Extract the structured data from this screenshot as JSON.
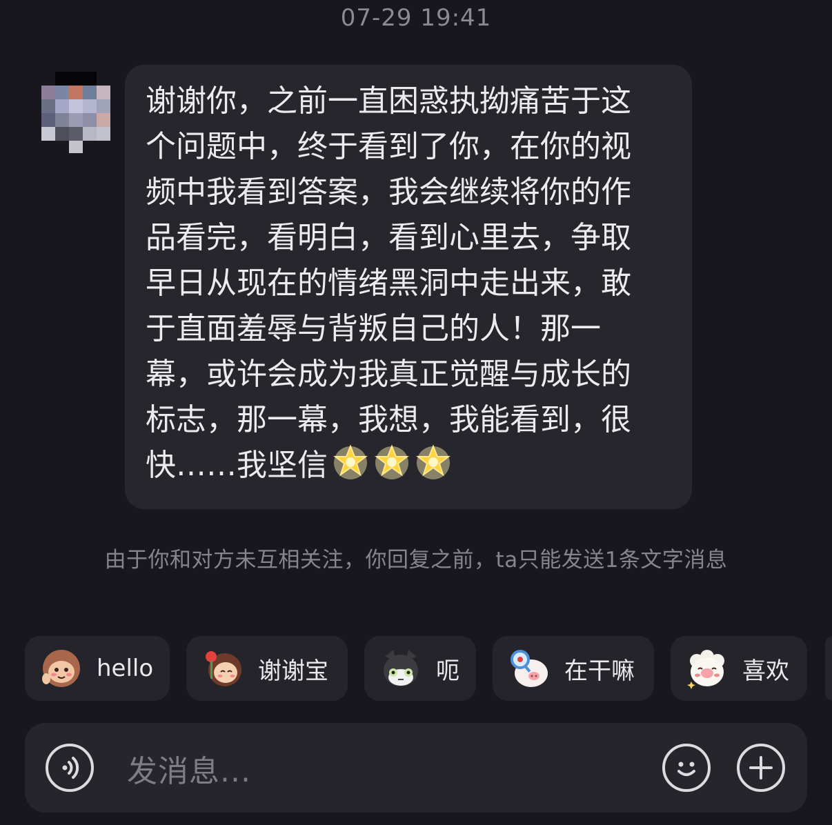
{
  "timestamp": "07-29 19:41",
  "message": {
    "lines": [
      "谢谢你，之前一直困惑执拗痛苦于这",
      "个问题中，终于看到了你，在你的视",
      "频中我看到答案，我会继续将你的作",
      "品看完，看明白，看到心里去，争取",
      "早日从现在的情绪黑洞中走出来，敢",
      "于直面羞辱与背叛自己的人！那一",
      "幕，或许会成为我真正觉醒与成长的",
      "标志，那一幕，我想，我能看到，很",
      "快……我坚信"
    ],
    "trailing_emoji": [
      "glowing-star",
      "glowing-star",
      "glowing-star"
    ]
  },
  "notice": "由于你和对方未互相关注，你回复之前，ta只能发送1条文字消息",
  "quick_replies": [
    {
      "label": "hello",
      "sticker": "waving-monkey-sticker"
    },
    {
      "label": "谢谢宝",
      "sticker": "girl-with-rose-sticker"
    },
    {
      "label": "呃",
      "sticker": "speechless-cat-sticker"
    },
    {
      "label": "在干嘛",
      "sticker": "magnifier-pig-sticker"
    },
    {
      "label": "喜欢",
      "sticker": "shy-sheep-sticker"
    }
  ],
  "input": {
    "placeholder": "发消息...",
    "voice_icon": "voice-icon",
    "emoji_icon": "emoji-icon",
    "plus_icon": "plus-icon"
  },
  "colors": {
    "background": "#17171d",
    "bubble": "#26262c",
    "chip": "#24242a",
    "muted_text": "#85858d"
  }
}
